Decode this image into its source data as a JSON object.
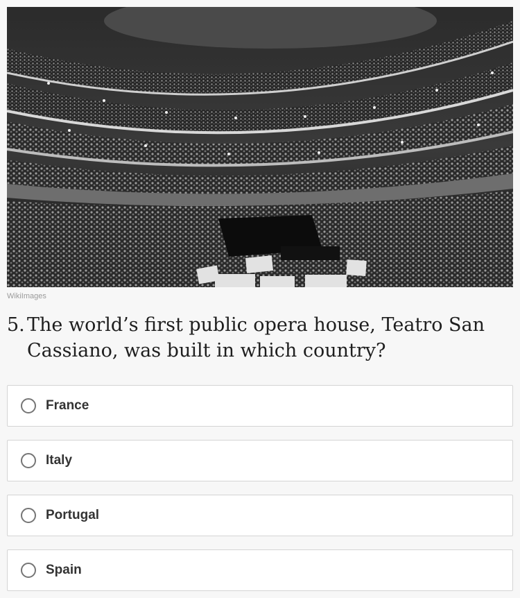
{
  "image": {
    "icon": "opera-house-photo",
    "credit": "WikiImages"
  },
  "question": {
    "number": "5.",
    "text": "The world’s first public opera house, Teatro San Cassiano, was built in which country?"
  },
  "options": [
    {
      "label": "France"
    },
    {
      "label": "Italy"
    },
    {
      "label": "Portugal"
    },
    {
      "label": "Spain"
    }
  ],
  "colors": {
    "background": "#f7f7f7",
    "option_border": "#d4d4d4",
    "radio": "#757575",
    "question_text": "#1e1e1e"
  }
}
